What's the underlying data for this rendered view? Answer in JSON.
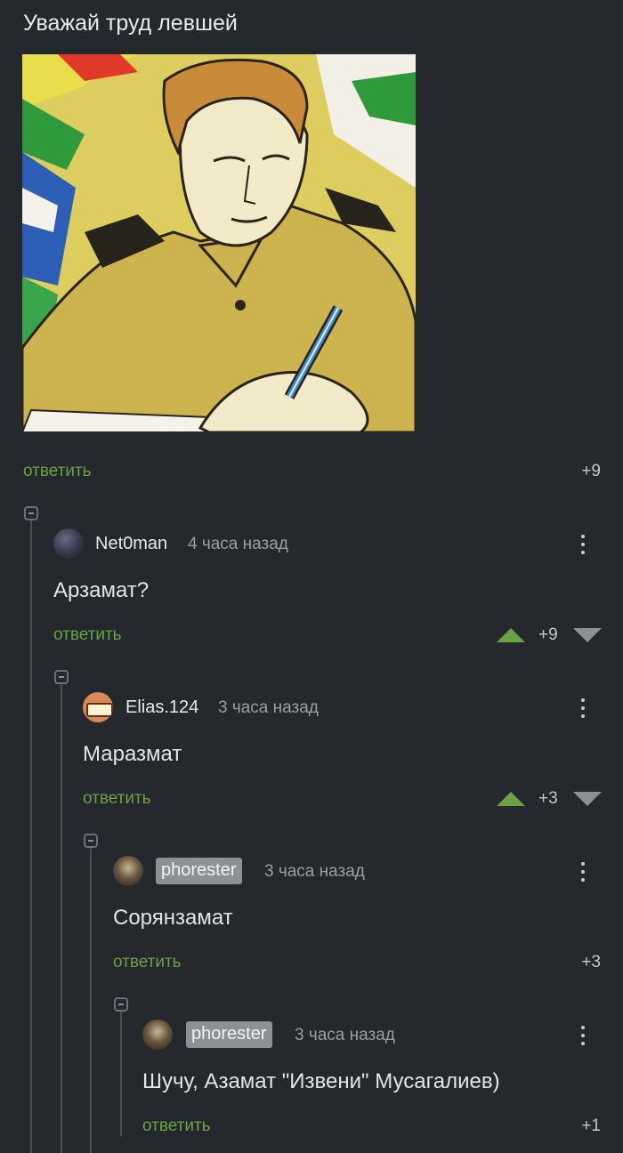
{
  "post": {
    "title": "Уважай труд левшей",
    "image_icon": "cartoon-officer-writing",
    "reply_label": "ответить",
    "rating": "+9"
  },
  "comments": [
    {
      "username": "Net0man",
      "time": "4 часа назад",
      "text": "Арзамат?",
      "reply_label": "ответить",
      "rating": "+9",
      "votes_visible": true
    },
    {
      "username": "Elias.124",
      "time": "3 часа назад",
      "text": "Маразмат",
      "reply_label": "ответить",
      "rating": "+3",
      "votes_visible": true
    },
    {
      "username": "phorester",
      "is_author": true,
      "time": "3 часа назад",
      "text": "Сорянзамат",
      "reply_label": "ответить",
      "rating": "+3",
      "votes_visible": false
    },
    {
      "username": "phorester",
      "is_author": true,
      "time": "3 часа назад",
      "text": "Шучу, Азамат \"Извени\" Мусагалиев)",
      "reply_label": "ответить",
      "rating": "+1",
      "votes_visible": false
    }
  ],
  "colors": {
    "background": "#25292d",
    "accent_green": "#6aa244",
    "author_badge": "#8d9095"
  }
}
